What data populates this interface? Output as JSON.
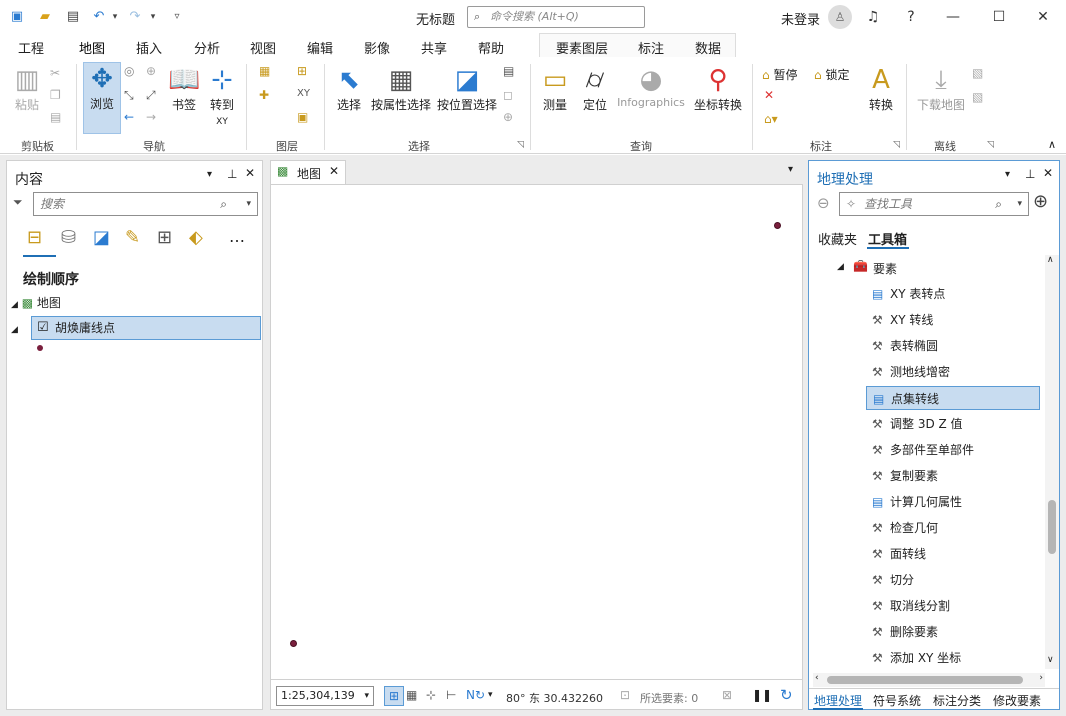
{
  "qat": {
    "title": "无标题",
    "search_placeholder": "命令搜索 (Alt+Q)",
    "user": "未登录"
  },
  "tabs": [
    "工程",
    "地图",
    "插入",
    "分析",
    "视图",
    "编辑",
    "影像",
    "共享",
    "帮助"
  ],
  "ctx_tabs": [
    "要素图层",
    "标注",
    "数据"
  ],
  "ribbon": {
    "paste": "粘贴",
    "browse": "浏览",
    "bookmark": "书签",
    "goto": "转到",
    "goto_sub": "XY",
    "select": "选择",
    "select_attr": "按属性选择",
    "select_loc": "按位置选择",
    "measure": "测量",
    "locate": "定位",
    "infographics": "Infographics",
    "coord": "坐标转换",
    "pause": "暂停",
    "lock": "锁定",
    "convert": "转换",
    "download": "下载地图",
    "groups": [
      "剪贴板",
      "导航",
      "图层",
      "选择",
      "查询",
      "标注",
      "离线"
    ]
  },
  "contents": {
    "title": "内容",
    "search_placeholder": "搜索",
    "draw_order": "绘制顺序",
    "map": "地图",
    "layer": "胡焕庸线点"
  },
  "map_tab": {
    "label": "地图"
  },
  "geoprocessing": {
    "title": "地理处理",
    "search_placeholder": "查找工具",
    "tab_fav": "收藏夹",
    "tab_toolbox": "工具箱",
    "folder": "要素",
    "tools": [
      "XY 表转点",
      "XY 转线",
      "表转椭圆",
      "测地线增密",
      "点集转线",
      "调整 3D Z 值",
      "多部件至单部件",
      "复制要素",
      "计算几何属性",
      "检查几何",
      "面转线",
      "切分",
      "取消线分割",
      "删除要素",
      "添加 XY 坐标"
    ],
    "selected_index": 4,
    "bottom_tabs": [
      "地理处理",
      "符号系统",
      "标注分类",
      "修改要素"
    ]
  },
  "status": {
    "scale": "1:25,304,139",
    "coord": "80° 东 30.432260",
    "selected": "所选要素: 0"
  },
  "colors": {
    "accent": "#1f6fb5",
    "selection": "#c8dcf0",
    "point": "#7a1f3d"
  }
}
